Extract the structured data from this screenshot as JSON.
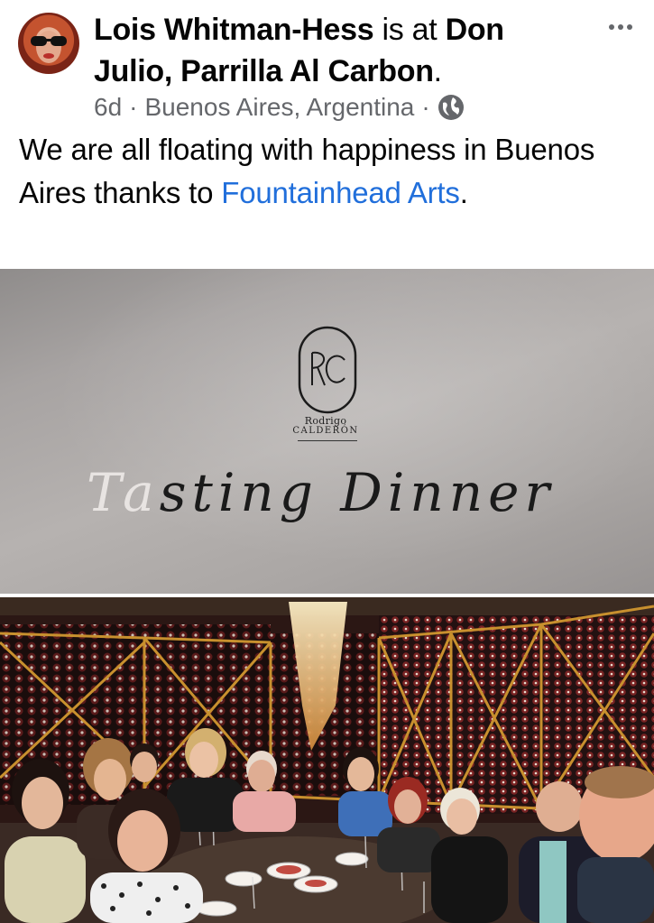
{
  "post": {
    "author": "Lois Whitman-Hess",
    "is_at_text": "is at",
    "place": "Don Julio, Parrilla Al Carbon",
    "period": ".",
    "time": "6d",
    "separator": "·",
    "location": "Buenos Aires, Argentina",
    "privacy_icon": "globe-icon",
    "more_icon": "more-horizontal-icon",
    "text_before_link": "We are all floating with happiness in Buenos Aires thanks to",
    "link_text": "Fountainhead Arts",
    "text_after_link": "."
  },
  "photo1": {
    "monogram": "RC",
    "brand_line1": "Rodrigo",
    "brand_line2": "CALDERÓN",
    "headline_faded": "Ta",
    "headline_rest": "sting Dinner"
  },
  "colors": {
    "link": "#216fdb",
    "meta": "#65676b",
    "text": "#050505"
  }
}
